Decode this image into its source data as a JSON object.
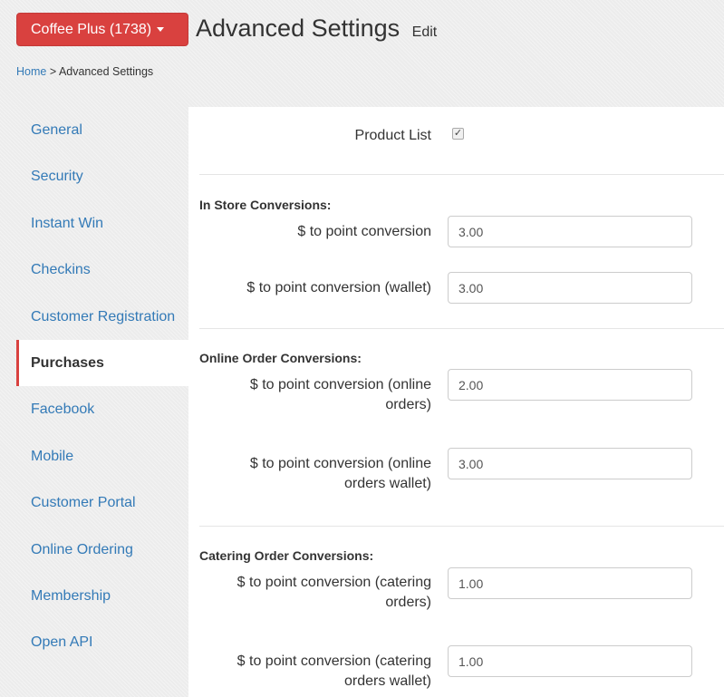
{
  "header": {
    "org_button_label": "Coffee Plus (1738)",
    "title": "Advanced Settings",
    "edit_label": "Edit"
  },
  "breadcrumb": {
    "home": "Home",
    "separator": ">",
    "current": "Advanced Settings"
  },
  "sidebar": {
    "items": [
      {
        "label": "General"
      },
      {
        "label": "Security"
      },
      {
        "label": "Instant Win"
      },
      {
        "label": "Checkins"
      },
      {
        "label": "Customer Registration"
      },
      {
        "label": "Purchases"
      },
      {
        "label": "Facebook"
      },
      {
        "label": "Mobile"
      },
      {
        "label": "Customer Portal"
      },
      {
        "label": "Online Ordering"
      },
      {
        "label": "Membership"
      },
      {
        "label": "Open API"
      }
    ],
    "active": "Purchases"
  },
  "form": {
    "product_list_label": "Product List",
    "product_list_checked": true,
    "in_store": {
      "heading": "In Store Conversions:",
      "point_conversion_label": "$ to point conversion",
      "point_conversion_value": "3.00",
      "wallet_label": "$ to point conversion (wallet)",
      "wallet_value": "3.00"
    },
    "online": {
      "heading": "Online Order Conversions:",
      "orders_label_line1": "$ to point conversion (online",
      "orders_label_line2": "orders)",
      "orders_value": "2.00",
      "wallet_label_line1": "$ to point conversion (online",
      "wallet_label_line2": "orders wallet)",
      "wallet_value": "3.00"
    },
    "catering": {
      "heading": "Catering Order Conversions:",
      "orders_label_line1": "$ to point conversion (catering",
      "orders_label_line2": "orders)",
      "orders_value": "1.00",
      "wallet_label_line1": "$ to point conversion (catering",
      "wallet_label_line2": "orders wallet)",
      "wallet_value": "1.00"
    }
  },
  "colors": {
    "accent": "#d9413f",
    "link": "#337ab7"
  }
}
